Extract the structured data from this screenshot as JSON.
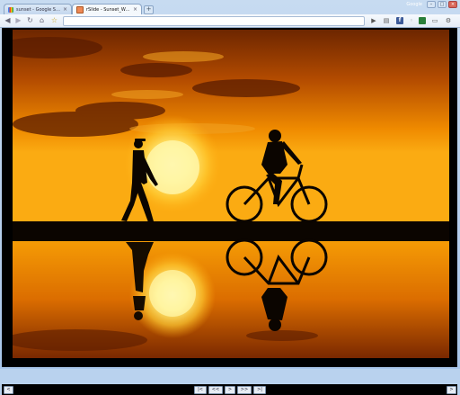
{
  "browser": {
    "tabs": [
      {
        "title": "sunset - Google Search",
        "favicon": "google-favicon",
        "active": false
      },
      {
        "title": "rSlide - Sunset_Walk_by_hank...",
        "favicon": "rslide-favicon",
        "active": true
      }
    ],
    "new_tab_label": "+",
    "profile_label": "Google",
    "window_buttons": {
      "minimize": "–",
      "maximize": "□",
      "close": "×"
    },
    "toolbar": {
      "back": "◀",
      "forward": "▶",
      "reload": "↻",
      "home": "⌂",
      "star": "☆",
      "play": "▶",
      "page_label": "▤",
      "facebook": "f",
      "wrench": "🔧"
    }
  },
  "slideshow": {
    "left_button": "<",
    "first": "|<",
    "prev": "<<",
    "play": ">",
    "next": ">>",
    "last": ">|",
    "right_button": ">"
  },
  "colors": {
    "sky_top": "#7a2f00",
    "sun": "#fff3a0",
    "horizon": "#f8a400",
    "silhouette": "#0b0500"
  }
}
